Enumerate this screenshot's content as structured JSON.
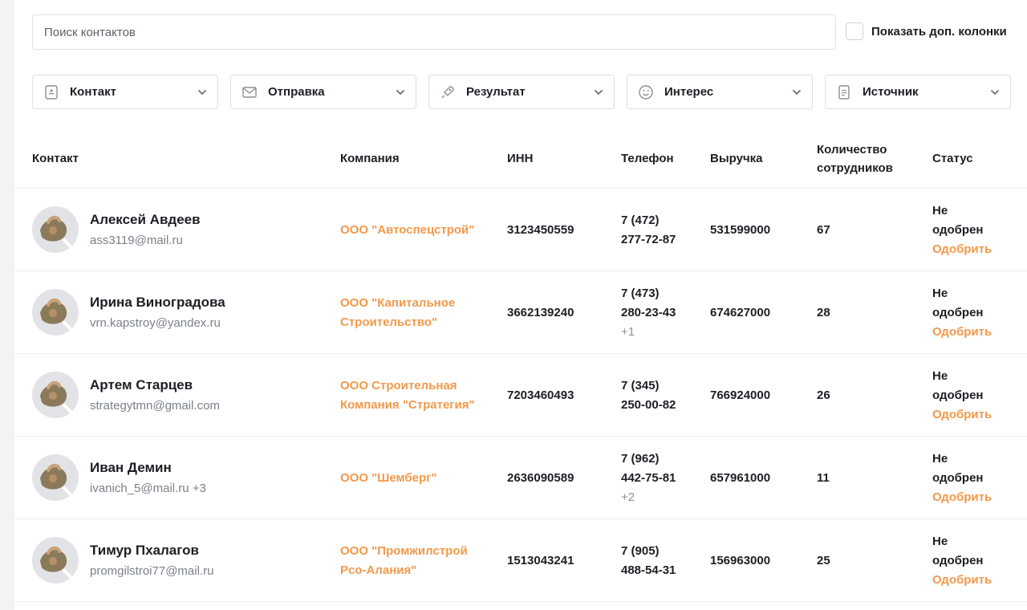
{
  "search": {
    "placeholder": "Поиск контактов"
  },
  "extra_columns": {
    "label": "Показать доп. колонки"
  },
  "filters": [
    {
      "label": "Контакт",
      "icon": "contact-card-icon"
    },
    {
      "label": "Отправка",
      "icon": "envelope-icon"
    },
    {
      "label": "Результат",
      "icon": "rocket-icon"
    },
    {
      "label": "Интерес",
      "icon": "smile-icon"
    },
    {
      "label": "Источник",
      "icon": "document-icon"
    }
  ],
  "columns": {
    "contact": "Контакт",
    "company": "Компания",
    "inn": "ИНН",
    "phone": "Телефон",
    "revenue": "Выручка",
    "staff": "Количество сотрудников",
    "status": "Статус"
  },
  "rows": [
    {
      "name": "Алексей Авдеев",
      "email": "ass3119@mail.ru",
      "email_extra": "",
      "company": "ООО \"Автоспецстрой\"",
      "inn": "3123450559",
      "phone": "7 (472) 277-72-87",
      "phone_extra": "",
      "revenue": "531599000",
      "staff": "67",
      "status": "Не одобрен",
      "action": "Одобрить"
    },
    {
      "name": "Ирина Виноградова",
      "email": "vrn.kapstroy@yandex.ru",
      "email_extra": "",
      "company": "ООО \"Капитальное Строительство\"",
      "inn": "3662139240",
      "phone": "7 (473) 280-23-43",
      "phone_extra": "+1",
      "revenue": "674627000",
      "staff": "28",
      "status": "Не одобрен",
      "action": "Одобрить"
    },
    {
      "name": "Артем Старцев",
      "email": "strategytmn@gmail.com",
      "email_extra": "",
      "company": "ООО Строительная Компания \"Стратегия\"",
      "inn": "7203460493",
      "phone": "7 (345) 250-00-82",
      "phone_extra": "",
      "revenue": "766924000",
      "staff": "26",
      "status": "Не одобрен",
      "action": "Одобрить"
    },
    {
      "name": "Иван Демин",
      "email": "ivanich_5@mail.ru",
      "email_extra": "+3",
      "company": "ООО \"Шемберг\"",
      "inn": "2636090589",
      "phone": "7 (962) 442-75-81",
      "phone_extra": "+2",
      "revenue": "657961000",
      "staff": "11",
      "status": "Не одобрен",
      "action": "Одобрить"
    },
    {
      "name": "Тимур Пхалагов",
      "email": "promgilstroi77@mail.ru",
      "email_extra": "",
      "company": "ООО \"Промжилстрой Рсо-Алания\"",
      "inn": "1513043241",
      "phone": "7 (905) 488-54-31",
      "phone_extra": "",
      "revenue": "156963000",
      "staff": "25",
      "status": "Не одобрен",
      "action": "Одобрить"
    }
  ],
  "colors": {
    "accent": "#f2994a",
    "text": "#1b1f24",
    "muted": "#7a8189",
    "border": "#dcdfe3"
  }
}
